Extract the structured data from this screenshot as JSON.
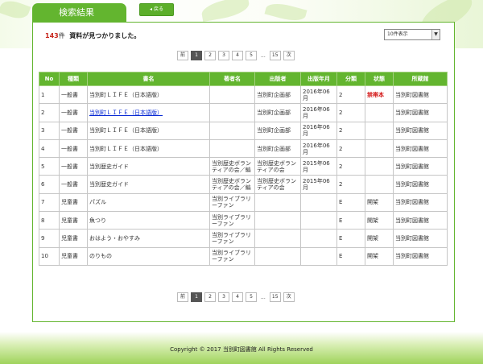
{
  "header": {
    "tab_title": "検索結果",
    "back_label": "◂ 戻る"
  },
  "summary": {
    "count": "143",
    "unit": "件",
    "message": "資料が見つかりました。"
  },
  "display_select": {
    "value": "10件表示",
    "arrow": "▼"
  },
  "pagination": {
    "prev": "前",
    "pages": [
      "1",
      "2",
      "3",
      "4",
      "5"
    ],
    "ellipsis": "...",
    "last": "15",
    "next": "次",
    "current": "1"
  },
  "table": {
    "columns": [
      "No",
      "種類",
      "書名",
      "著者名",
      "出版者",
      "出版年月",
      "分類",
      "状態",
      "所蔵館"
    ],
    "rows": [
      [
        "1",
        "一般書",
        "当別町ＬＩＦＥ（日本語版）",
        "",
        "当別町企画部",
        "2016年06月",
        "2",
        "禁帯本",
        "当別町図書館"
      ],
      [
        "2",
        "一般書",
        "当別町ＬＩＦＥ（日本語版）",
        "",
        "当別町企画部",
        "2016年06月",
        "2",
        "",
        "当別町図書館"
      ],
      [
        "3",
        "一般書",
        "当別町ＬＩＦＥ（日本語版）",
        "",
        "当別町企画部",
        "2016年06月",
        "2",
        "",
        "当別町図書館"
      ],
      [
        "4",
        "一般書",
        "当別町ＬＩＦＥ（日本語版）",
        "",
        "当別町企画部",
        "2016年06月",
        "2",
        "",
        "当別町図書館"
      ],
      [
        "5",
        "一般書",
        "当別歴史ガイド",
        "当別歴史ボランティアの会／編",
        "当別歴史ボランティアの会",
        "2015年06月",
        "2",
        "",
        "当別町図書館"
      ],
      [
        "6",
        "一般書",
        "当別歴史ガイド",
        "当別歴史ボランティアの会／編",
        "当別歴史ボランティアの会",
        "2015年06月",
        "2",
        "",
        "当別町図書館"
      ],
      [
        "7",
        "児童書",
        "パズル",
        "当別ライブラリーファン",
        "",
        "",
        "E",
        "開架",
        "当別町図書館"
      ],
      [
        "8",
        "児童書",
        "魚つり",
        "当別ライブラリーファン",
        "",
        "",
        "E",
        "開架",
        "当別町図書館"
      ],
      [
        "9",
        "児童書",
        "おはよう・おやすみ",
        "当別ライブラリーファン",
        "",
        "",
        "E",
        "開架",
        "当別町図書館"
      ],
      [
        "10",
        "児童書",
        "のりもの",
        "当別ライブラリーファン",
        "",
        "",
        "E",
        "開架",
        "当別町図書館"
      ]
    ]
  },
  "footer": {
    "copyright": "Copyright © 2017 当別町図書館 All Rights Reserved"
  },
  "colors": {
    "accent": "#63b52f",
    "count_red": "#c8281e",
    "link_blue": "#0a2bd4"
  }
}
